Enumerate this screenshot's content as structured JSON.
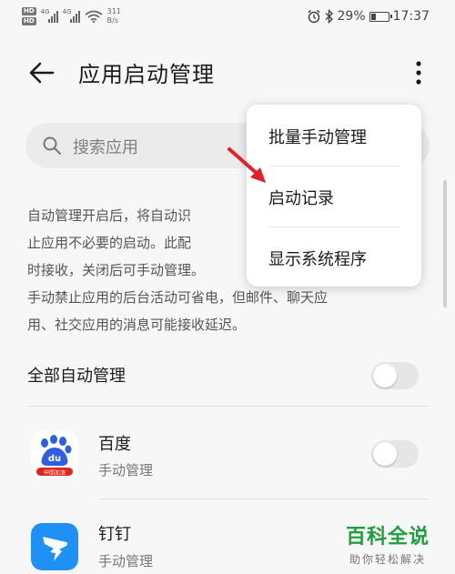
{
  "status_bar": {
    "hd1": "HD",
    "hd2": "HD",
    "net1": "4G",
    "net2": "4G",
    "speed_value": "311",
    "speed_unit": "B/s",
    "battery_percent": 29,
    "battery_text": "29%",
    "time": "17:37"
  },
  "header": {
    "title": "应用启动管理"
  },
  "search": {
    "placeholder": "搜索应用"
  },
  "description": {
    "lines": [
      "自动管理开启后，将自动识",
      "止应用不必要的启动。此配",
      "时接收，关闭后可手动管理。",
      "手动禁止应用的后台活动可省电，但邮件、聊天应",
      "用、社交应用的消息可能接收延迟。"
    ]
  },
  "all_auto": {
    "label": "全部自动管理"
  },
  "apps": [
    {
      "name": "百度",
      "status": "手动管理",
      "icon_badge": "中国加油",
      "icon_text": "du"
    },
    {
      "name": "钉钉",
      "status": "手动管理"
    }
  ],
  "menu": {
    "items": [
      "批量手动管理",
      "启动记录",
      "显示系统程序"
    ]
  },
  "watermark": {
    "main": "百科全说",
    "sub": "助你轻松解决"
  },
  "colors": {
    "annotation_arrow": "#e3202a",
    "baidu_blue": "#2f5fe0",
    "baidu_red": "#e0241c",
    "dingtalk_blue": "#1f90f5",
    "watermark_green": "#1ea03c"
  }
}
